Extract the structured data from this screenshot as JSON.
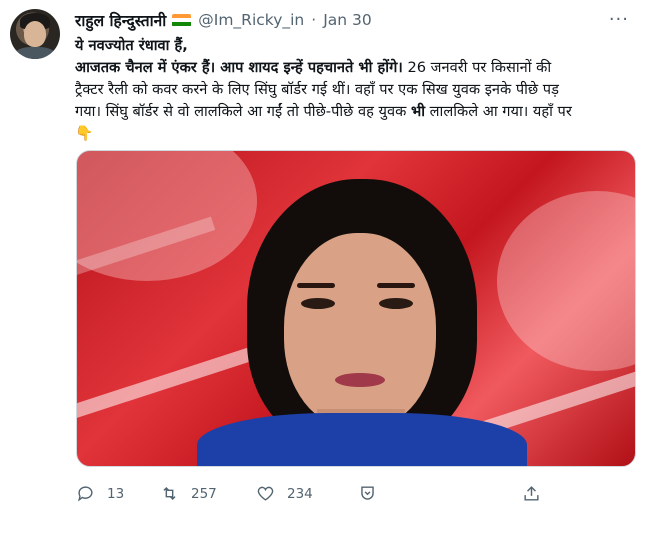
{
  "tweet": {
    "author_name": "राहुल हिन्दुस्तानी",
    "handle": "@Im_Ricky_in",
    "separator": "·",
    "date": "Jan 30",
    "more_label": "···",
    "text_lines": [
      {
        "bold": "ये नवज्योत रंधावा हैं,",
        "rest": ""
      },
      {
        "bold": "आजतक चैनल में एंकर हैं। आप शायद इन्हें पहचानते भी होंगे।",
        "rest": " 26 जनवरी पर किसानों की"
      },
      {
        "bold": "",
        "rest": "ट्रैक्टर रैली को कवर करने के लिए सिंघु बॉर्डर गई थीं। वहाँ पर एक सिख युवक इनके पीछे पड़"
      },
      {
        "bold": "",
        "rest": "गया। सिंघु बॉर्डर से वो लालकिले आ गईं तो पीछे-पीछे वह युवक ",
        "bold2": "भी",
        "rest2": " लालकिले आ गया। यहाँ पर"
      }
    ],
    "emoji": "👇",
    "replies": "13",
    "retweets": "257",
    "likes": "234"
  },
  "colors": {
    "text": "#0f1419",
    "muted": "#536471",
    "flag_saffron": "#ff9933",
    "flag_white": "#ffffff",
    "flag_green": "#138808"
  },
  "icons": [
    "reply-icon",
    "retweet-icon",
    "like-icon",
    "downvote-icon",
    "share-icon",
    "more-icon"
  ]
}
